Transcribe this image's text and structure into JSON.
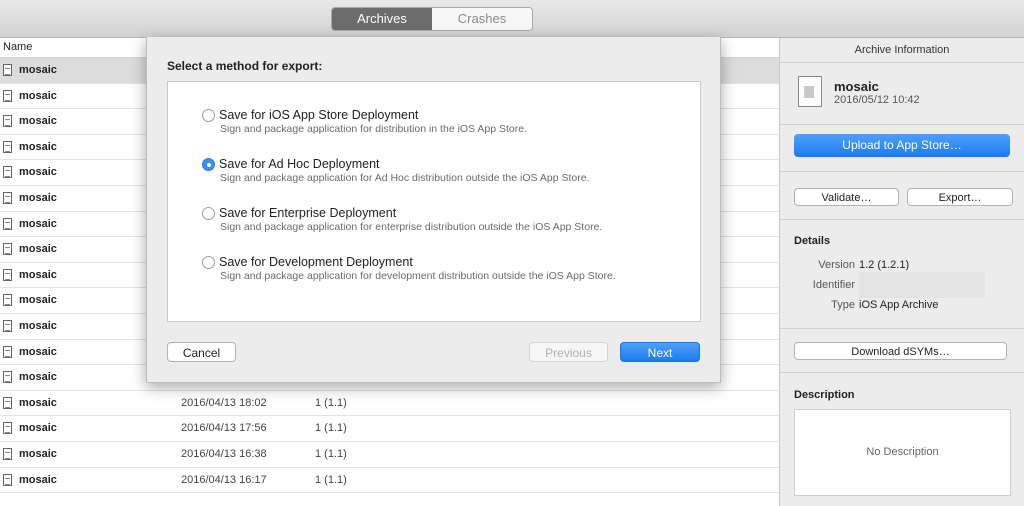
{
  "toolbar": {
    "tabs": [
      "Archives",
      "Crashes"
    ]
  },
  "list": {
    "header_name": "Name",
    "rows": [
      {
        "name": "mosaic",
        "date": "",
        "version": ""
      },
      {
        "name": "mosaic",
        "date": "",
        "version": ""
      },
      {
        "name": "mosaic",
        "date": "",
        "version": ""
      },
      {
        "name": "mosaic",
        "date": "",
        "version": ""
      },
      {
        "name": "mosaic",
        "date": "",
        "version": ""
      },
      {
        "name": "mosaic",
        "date": "",
        "version": ""
      },
      {
        "name": "mosaic",
        "date": "",
        "version": ""
      },
      {
        "name": "mosaic",
        "date": "",
        "version": ""
      },
      {
        "name": "mosaic",
        "date": "",
        "version": ""
      },
      {
        "name": "mosaic",
        "date": "",
        "version": ""
      },
      {
        "name": "mosaic",
        "date": "",
        "version": ""
      },
      {
        "name": "mosaic",
        "date": "",
        "version": ""
      },
      {
        "name": "mosaic",
        "date": "",
        "version": ""
      },
      {
        "name": "mosaic",
        "date": "2016/04/13 18:02",
        "version": "1 (1.1)"
      },
      {
        "name": "mosaic",
        "date": "2016/04/13 17:56",
        "version": "1 (1.1)"
      },
      {
        "name": "mosaic",
        "date": "2016/04/13 16:38",
        "version": "1 (1.1)"
      },
      {
        "name": "mosaic",
        "date": "2016/04/13 16:17",
        "version": "1 (1.1)"
      }
    ]
  },
  "sidebar": {
    "title": "Archive Information",
    "archive_name": "mosaic",
    "archive_date": "2016/05/12 10:42",
    "upload_label": "Upload to App Store…",
    "validate_label": "Validate…",
    "export_label": "Export…",
    "details_heading": "Details",
    "version_label": "Version",
    "version_value": "1.2 (1.2.1)",
    "identifier_label": "Identifier",
    "type_label": "Type",
    "type_value": "iOS App Archive",
    "dsyms_label": "Download dSYMs…",
    "description_heading": "Description",
    "description_placeholder": "No Description"
  },
  "sheet": {
    "title": "Select a method for export:",
    "options": [
      {
        "title": "Save for iOS App Store Deployment",
        "desc": "Sign and package application for distribution in the iOS App Store.",
        "checked": false
      },
      {
        "title": "Save for Ad Hoc Deployment",
        "desc": "Sign and package application for Ad Hoc distribution outside the iOS App Store.",
        "checked": true
      },
      {
        "title": "Save for Enterprise Deployment",
        "desc": "Sign and package application for enterprise distribution outside the iOS App Store.",
        "checked": false
      },
      {
        "title": "Save for Development Deployment",
        "desc": "Sign and package application for development distribution outside the iOS App Store.",
        "checked": false
      }
    ],
    "cancel_label": "Cancel",
    "previous_label": "Previous",
    "next_label": "Next"
  }
}
